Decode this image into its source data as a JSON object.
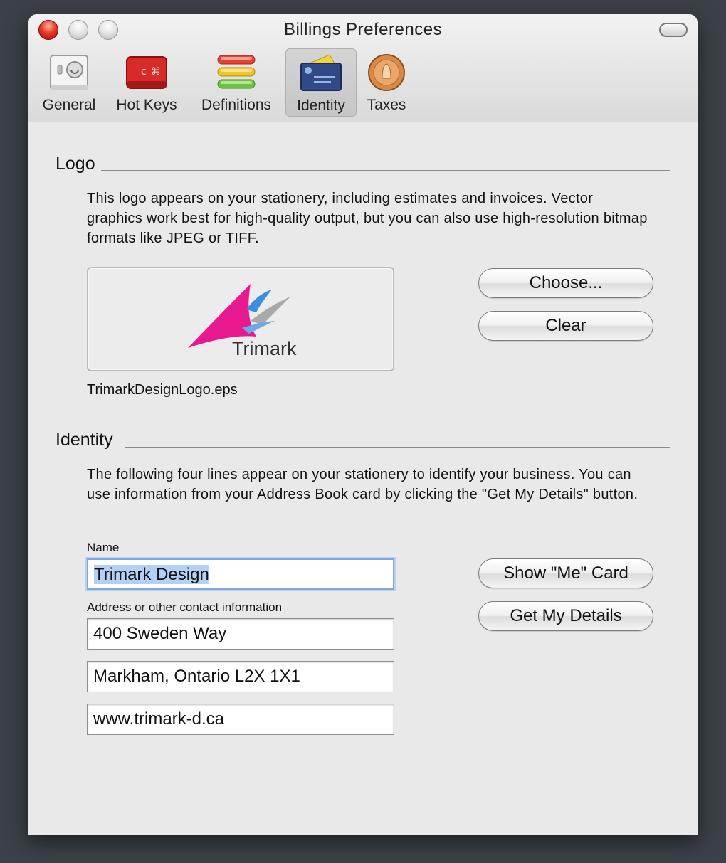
{
  "window": {
    "title": "Billings Preferences"
  },
  "toolbar": {
    "items": [
      {
        "label": "General",
        "icon": "general-switch-icon"
      },
      {
        "label": "Hot Keys",
        "icon": "hot-keys-icon"
      },
      {
        "label": "Definitions",
        "icon": "definitions-icon"
      },
      {
        "label": "Identity",
        "icon": "identity-card-icon",
        "selected": true
      },
      {
        "label": "Taxes",
        "icon": "taxes-icon"
      }
    ]
  },
  "logo_section": {
    "header": "Logo",
    "description": "This logo appears on your stationery, including estimates and invoices. Vector graphics work best for high-quality output, but you can also use high-resolution bitmap formats like JPEG or TIFF.",
    "logo_text": "Trimark",
    "filename": "TrimarkDesignLogo.eps",
    "choose_label": "Choose...",
    "clear_label": "Clear"
  },
  "identity_section": {
    "header": "Identity",
    "description": "The following four lines appear on your stationery to identify your business. You can use information from your Address Book card by clicking the \"Get My Details\" button.",
    "name_label": "Name",
    "name_value": "Trimark Design",
    "address_label": "Address or other contact information",
    "address_lines": [
      "400 Sweden Way",
      "Markham, Ontario L2X 1X1",
      "www.trimark-d.ca"
    ],
    "show_me_card_label": "Show \"Me\" Card",
    "get_my_details_label": "Get My Details"
  },
  "colors": {
    "accent_focus": "#7ea7e0",
    "logo_pink": "#e8188f",
    "logo_blue": "#3b8fe0",
    "close_red": "#e83a2a"
  }
}
